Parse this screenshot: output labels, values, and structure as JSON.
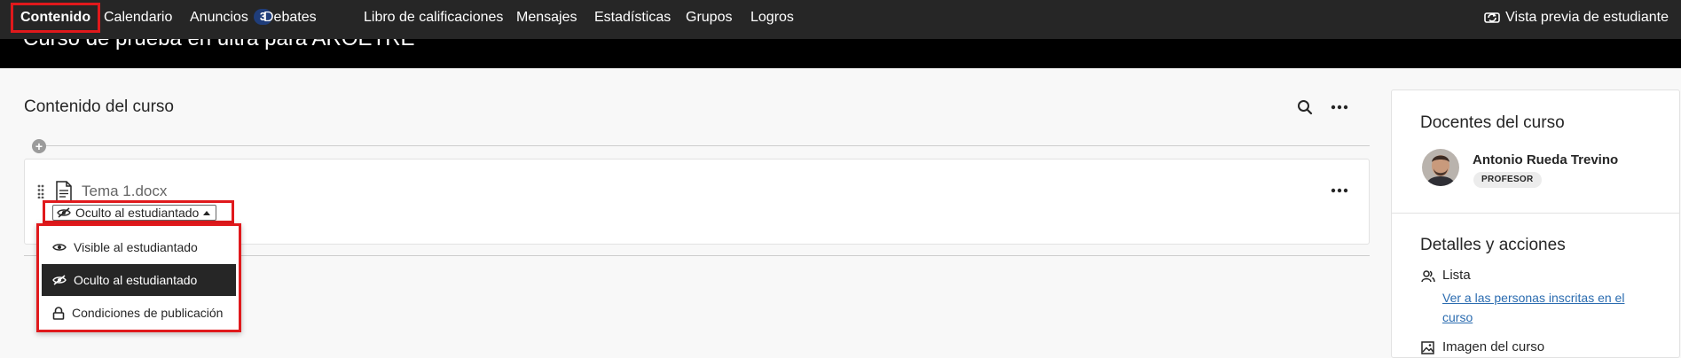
{
  "nav": {
    "items": [
      {
        "label": "Contenido"
      },
      {
        "label": "Calendario"
      },
      {
        "label": "Anuncios",
        "badge": "3"
      },
      {
        "label": "Debates"
      },
      {
        "label": "Libro de calificaciones"
      },
      {
        "label": "Mensajes"
      },
      {
        "label": "Estadísticas"
      },
      {
        "label": "Grupos"
      },
      {
        "label": "Logros"
      }
    ],
    "preview_label": "Vista previa de estudiante"
  },
  "banner": {
    "course_title": "Curso de prueba en ultra para AROETRE"
  },
  "content": {
    "section_title": "Contenido del curso",
    "item": {
      "title": "Tema 1.docx",
      "visibility_label": "Oculto al estudiantado"
    },
    "dropdown": {
      "options": [
        {
          "label": "Visible al estudiantado",
          "icon": "eye-icon"
        },
        {
          "label": "Oculto al estudiantado",
          "icon": "eye-slash-icon",
          "selected": true
        },
        {
          "label": "Condiciones de publicación",
          "icon": "lock-icon"
        }
      ]
    }
  },
  "sidebar": {
    "teachers_heading": "Docentes del curso",
    "teacher_name": "Antonio Rueda Trevino",
    "teacher_role": "PROFESOR",
    "details_heading": "Detalles y acciones",
    "list_label": "Lista",
    "list_link": "Ver a las personas inscritas en el curso",
    "course_image_label": "Imagen del curso"
  },
  "colors": {
    "nav_bg": "#262626",
    "highlight": "#e0191c",
    "badge_bg": "#1f3d7a",
    "link": "#2b6cb0"
  }
}
